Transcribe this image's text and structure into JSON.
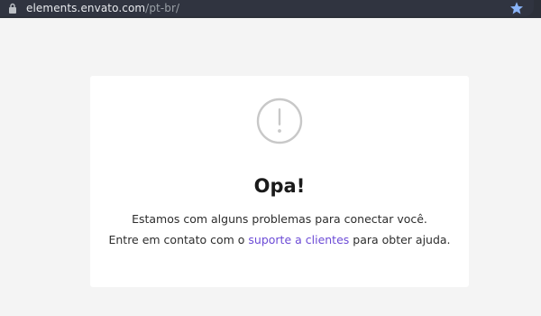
{
  "browser": {
    "url_host": "elements.envato.com",
    "url_path": "/pt-br/",
    "lock_icon": "lock-icon",
    "bookmark_icon": "star-icon",
    "star_color": "#8ab4f8"
  },
  "error_card": {
    "icon": "exclamation-circle-icon",
    "title": "Opa!",
    "line1": "Estamos com alguns problemas para conectar você.",
    "line2_before": "Entre em contato com o ",
    "line2_link": "suporte a clientes",
    "line2_after": " para obter ajuda.",
    "link_color": "#6c4bd6"
  }
}
